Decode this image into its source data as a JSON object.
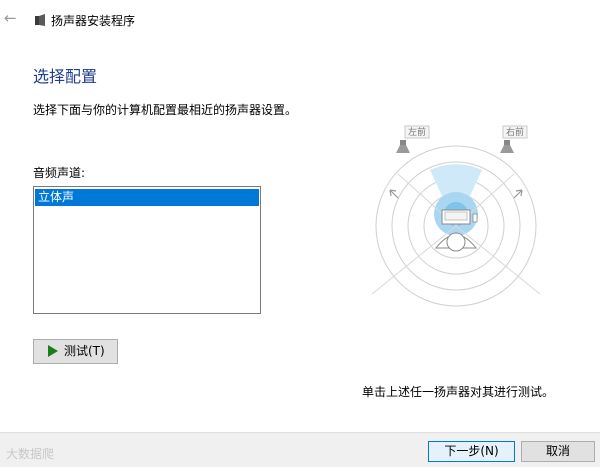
{
  "window": {
    "title": "扬声器安装程序",
    "icon": "speaker-app-icon",
    "back_icon": "back-arrow-icon"
  },
  "page": {
    "heading": "选择配置",
    "description": "选择下面与你的计算机配置最相近的扬声器设置。"
  },
  "channels": {
    "label": "音频声道:",
    "items": [
      "立体声"
    ],
    "selected": "立体声"
  },
  "test_button": {
    "label": "测试(T)"
  },
  "diagram": {
    "left_speaker_label": "左前",
    "right_speaker_label": "右前"
  },
  "hint": "单击上述任一扬声器对其进行测试。",
  "footer": {
    "next_label": "下一步(N)",
    "cancel_label": "取消",
    "watermark": "大数据爬"
  },
  "colors": {
    "accent": "#0078d7",
    "heading": "#1f3f8f",
    "play_icon": "#1a7f1a"
  }
}
